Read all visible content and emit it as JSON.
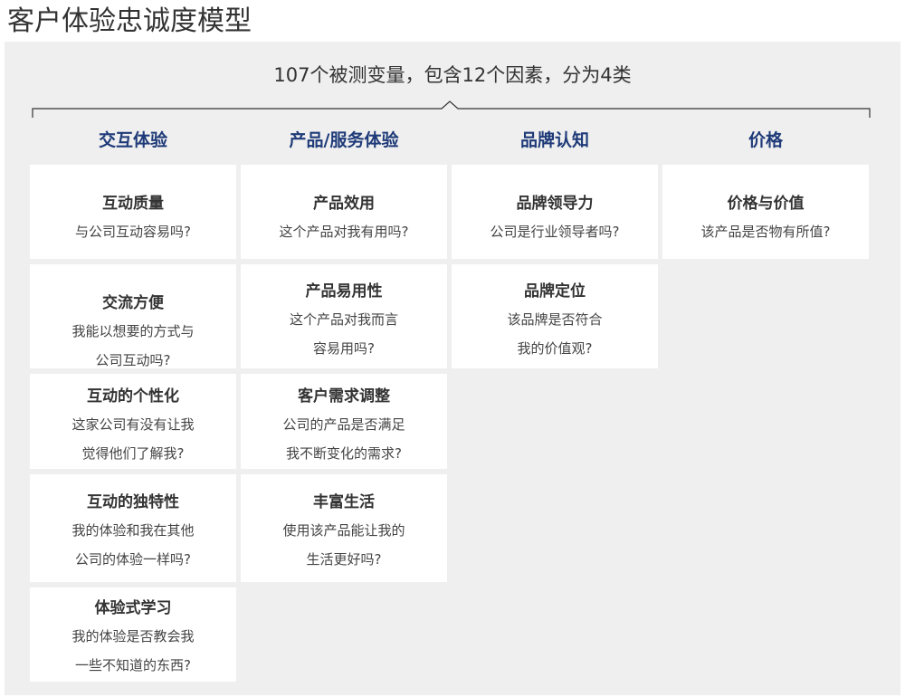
{
  "title": "客户体验忠诚度模型",
  "subtitle": "107个被测变量，包含12个因素，分为4类",
  "categories": [
    {
      "name": "交互体验",
      "items": [
        {
          "title": "互动质量",
          "desc": "与公司互动容易吗?"
        },
        {
          "title": "交流方便",
          "desc": "我能以想要的方式与\n公司互动吗?"
        },
        {
          "title": "互动的个性化",
          "desc": "这家公司有没有让我\n觉得他们了解我?"
        },
        {
          "title": "互动的独特性",
          "desc": "我的体验和我在其他\n公司的体验一样吗?"
        },
        {
          "title": "体验式学习",
          "desc": "我的体验是否教会我\n一些不知道的东西?"
        }
      ]
    },
    {
      "name": "产品/服务体验",
      "items": [
        {
          "title": "产品效用",
          "desc": "这个产品对我有用吗?"
        },
        {
          "title": "产品易用性",
          "desc": "这个产品对我而言\n容易用吗?"
        },
        {
          "title": "客户需求调整",
          "desc": "公司的产品是否满足\n我不断变化的需求?"
        },
        {
          "title": "丰富生活",
          "desc": "使用该产品能让我的\n生活更好吗?"
        }
      ]
    },
    {
      "name": "品牌认知",
      "items": [
        {
          "title": "品牌领导力",
          "desc": "公司是行业领导者吗?"
        },
        {
          "title": "品牌定位",
          "desc": "该品牌是否符合\n我的价值观?"
        }
      ]
    },
    {
      "name": "价格",
      "items": [
        {
          "title": "价格与价值",
          "desc": "该产品是否物有所值?"
        }
      ]
    }
  ]
}
